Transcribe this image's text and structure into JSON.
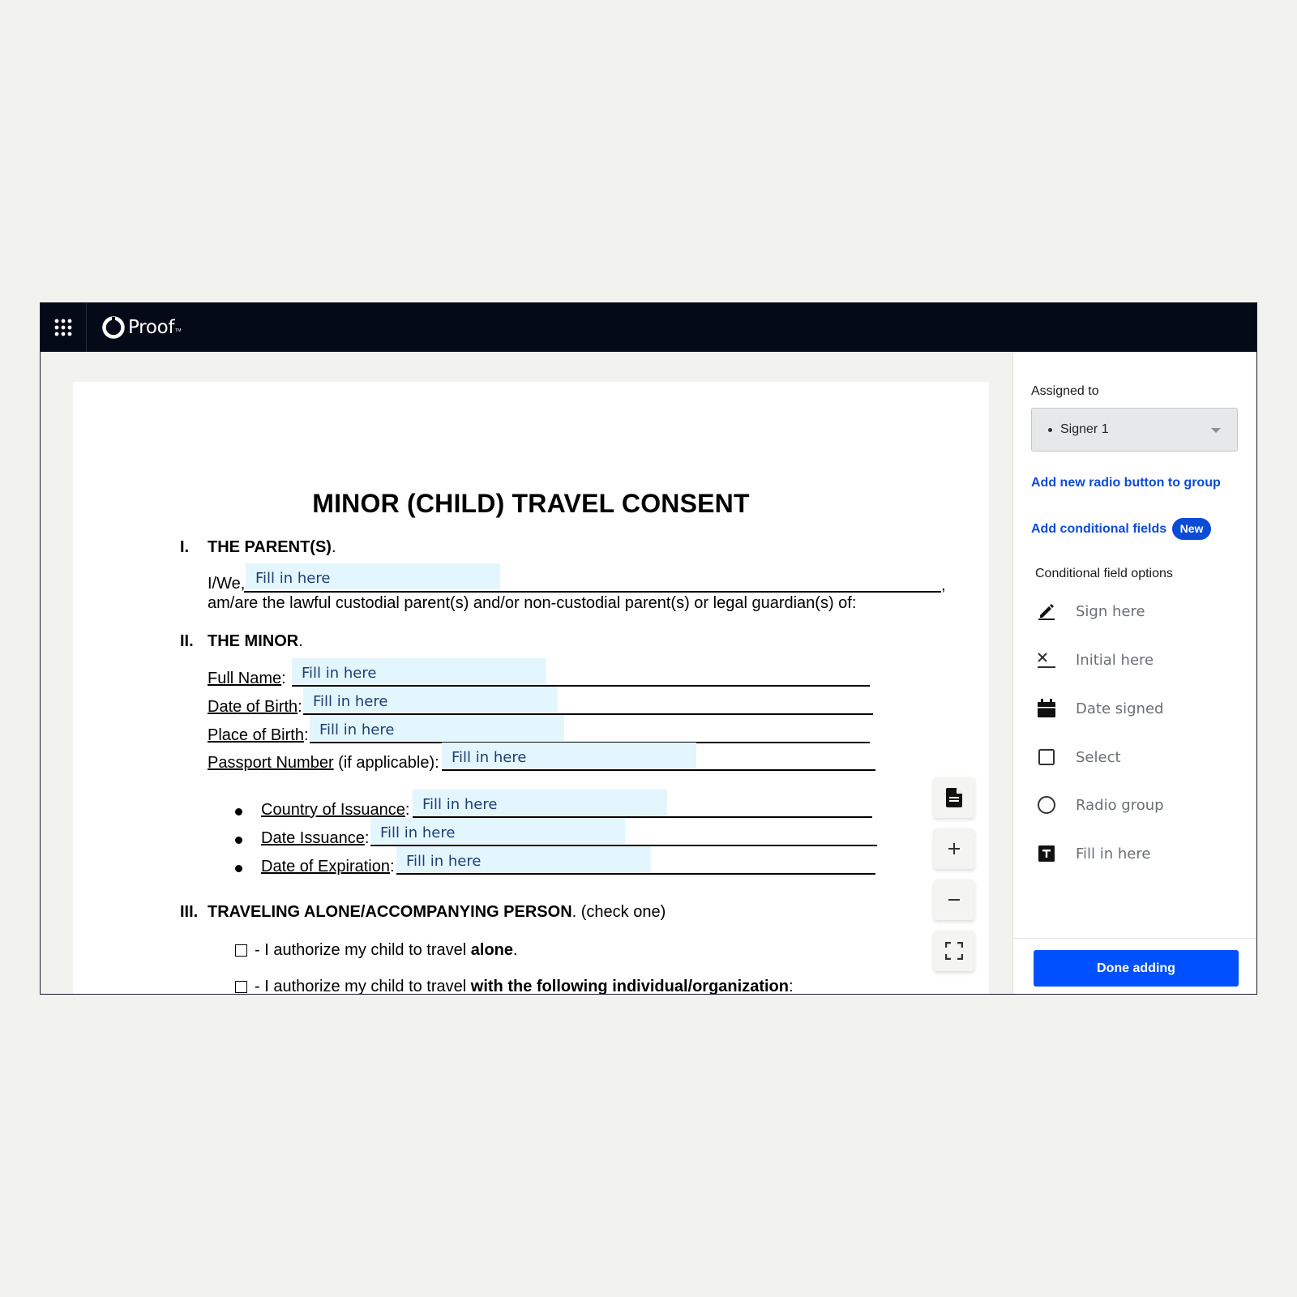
{
  "header": {
    "brand": "Proof",
    "brand_tm": "TM"
  },
  "document": {
    "title": "MINOR (CHILD) TRAVEL CONSENT",
    "section1": {
      "num": "I.",
      "title": "THE PARENT(S)",
      "dot": "."
    },
    "iwe_label": "I/We,",
    "comma": ",",
    "custodial_text": "am/are the lawful custodial parent(s) and/or non-custodial parent(s) or legal guardian(s) of:",
    "section2": {
      "num": "II.",
      "title": "THE MINOR",
      "dot": "."
    },
    "full_name_label": "Full Name",
    "dob_label": "Date of Birth",
    "pob_label": "Place of Birth",
    "passport_label": "Passport Number",
    "passport_suffix": " (if applicable):",
    "colon": ":",
    "country_label": "Country of Issuance",
    "date_issuance_label": "Date Issuance",
    "date_expiration_label": "Date of Expiration",
    "section3": {
      "num": "III.",
      "title": "TRAVELING ALONE/ACCOMPANYING PERSON",
      "suffix": ". (check one)"
    },
    "option_alone_pre": "- I authorize my child to travel ",
    "option_alone_bold": "alone",
    "option_alone_post": ".",
    "option_with_pre": "- I authorize my child to travel ",
    "option_with_bold": "with the following individual/organization",
    "option_with_post": ":",
    "fill_placeholder": "Fill in here"
  },
  "panel": {
    "assigned_label": "Assigned to",
    "assigned_value": "Signer 1",
    "add_radio_link": "Add new radio button to group",
    "add_conditional_link": "Add conditional fields",
    "new_badge": "New",
    "conditional_options_label": "Conditional field options",
    "options": [
      "Sign here",
      "Initial here",
      "Date signed",
      "Select",
      "Radio group",
      "Fill in here"
    ],
    "done_button": "Done adding"
  },
  "colors": {
    "accent": "#0050ff",
    "link": "#0b4bd8",
    "fill_bg": "#e3f6fd",
    "topbar": "#050a18"
  }
}
